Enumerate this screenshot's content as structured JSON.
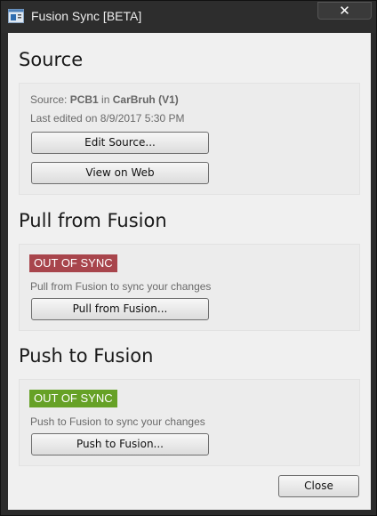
{
  "window": {
    "title": "Fusion Sync [BETA]",
    "close_glyph": "✕"
  },
  "source": {
    "heading": "Source",
    "prefix": "Source: ",
    "board": "PCB1",
    "in_word": " in ",
    "project": "CarBruh (V1)",
    "last_edited": "Last edited on 8/9/2017 5:30 PM",
    "edit_button": "Edit Source...",
    "web_button": "View on Web"
  },
  "pull": {
    "heading": "Pull from Fusion",
    "status": "OUT OF SYNC",
    "status_color": "#a8454c",
    "hint": "Pull from Fusion to sync your changes",
    "button": "Pull from Fusion..."
  },
  "push": {
    "heading": "Push to Fusion",
    "status": "OUT OF SYNC",
    "status_color": "#66a126",
    "hint": "Push to Fusion to sync your changes",
    "button": "Push to Fusion..."
  },
  "footer": {
    "close_button": "Close"
  }
}
